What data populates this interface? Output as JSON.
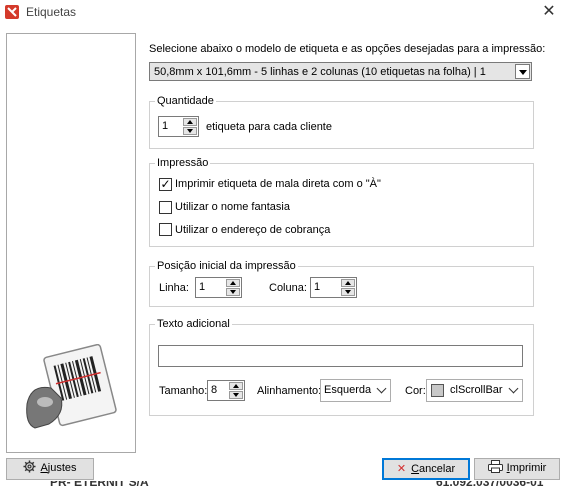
{
  "window": {
    "title": "Etiquetas",
    "close_glyph": "✕"
  },
  "model": {
    "prompt": "Selecione abaixo o modelo de etiqueta e as opções desejadas para a impressão:",
    "selected": "50,8mm x 101,6mm - 5 linhas e 2 colunas (10 etiquetas na folha) | 1"
  },
  "quantidade": {
    "title": "Quantidade",
    "value": "1",
    "suffix": "etiqueta para cada cliente"
  },
  "impressao": {
    "title": "Impressão",
    "options": [
      {
        "label": "Imprimir etiqueta de mala direta com o \"À\"",
        "checked": true
      },
      {
        "label": "Utilizar o nome fantasia",
        "checked": false
      },
      {
        "label": "Utilizar o endereço de cobrança",
        "checked": false
      }
    ]
  },
  "posicao": {
    "title": "Posição inicial da impressão",
    "linha_label": "Linha:",
    "linha_value": "1",
    "coluna_label": "Coluna:",
    "coluna_value": "1"
  },
  "texto": {
    "title": "Texto adicional",
    "value": "",
    "tamanho_label": "Tamanho:",
    "tamanho_value": "8",
    "alinhamento_label": "Alinhamento:",
    "alinhamento_value": "Esquerda",
    "cor_label": "Cor:",
    "cor_value": "clScrollBar",
    "cor_swatch": "#c8c8c8"
  },
  "buttons": {
    "ajustes_first": "A",
    "ajustes_rest": "justes",
    "cancelar_first": "C",
    "cancelar_rest": "ancelar",
    "imprimir_first": "I",
    "imprimir_rest": "mprimir"
  },
  "background": {
    "left_text": "PR- ETERNIT S/A",
    "right_text": "61.092.037/0036-01"
  },
  "colors": {
    "accent": "#0078d7",
    "cancel_icon": "#d32f2f",
    "brand": "#d43a2b"
  }
}
